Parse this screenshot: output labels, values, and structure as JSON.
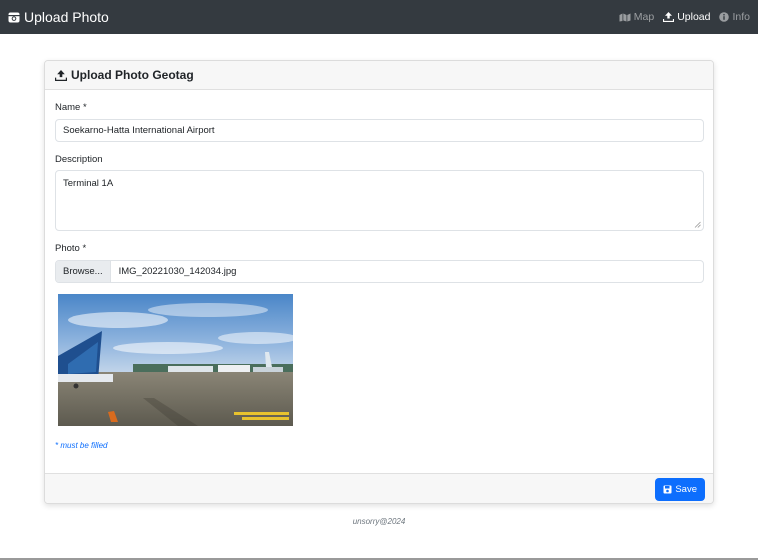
{
  "navbar": {
    "brand": "Upload Photo",
    "links": [
      {
        "label": "Map",
        "icon": "map-icon",
        "active": false
      },
      {
        "label": "Upload",
        "icon": "upload-icon",
        "active": true
      },
      {
        "label": "Info",
        "icon": "info-icon",
        "active": false
      }
    ]
  },
  "card": {
    "title": "Upload Photo Geotag",
    "name_label": "Name *",
    "name_value": "Soekarno-Hatta International Airport",
    "description_label": "Description",
    "description_value": "Terminal 1A",
    "photo_label": "Photo *",
    "browse_label": "Browse...",
    "file_name": "IMG_20221030_142034.jpg",
    "note": "* must be filled",
    "save_label": "Save"
  },
  "footer": "unsorry@2024",
  "colors": {
    "navbar": "#343a40",
    "primary": "#0d6efd"
  }
}
